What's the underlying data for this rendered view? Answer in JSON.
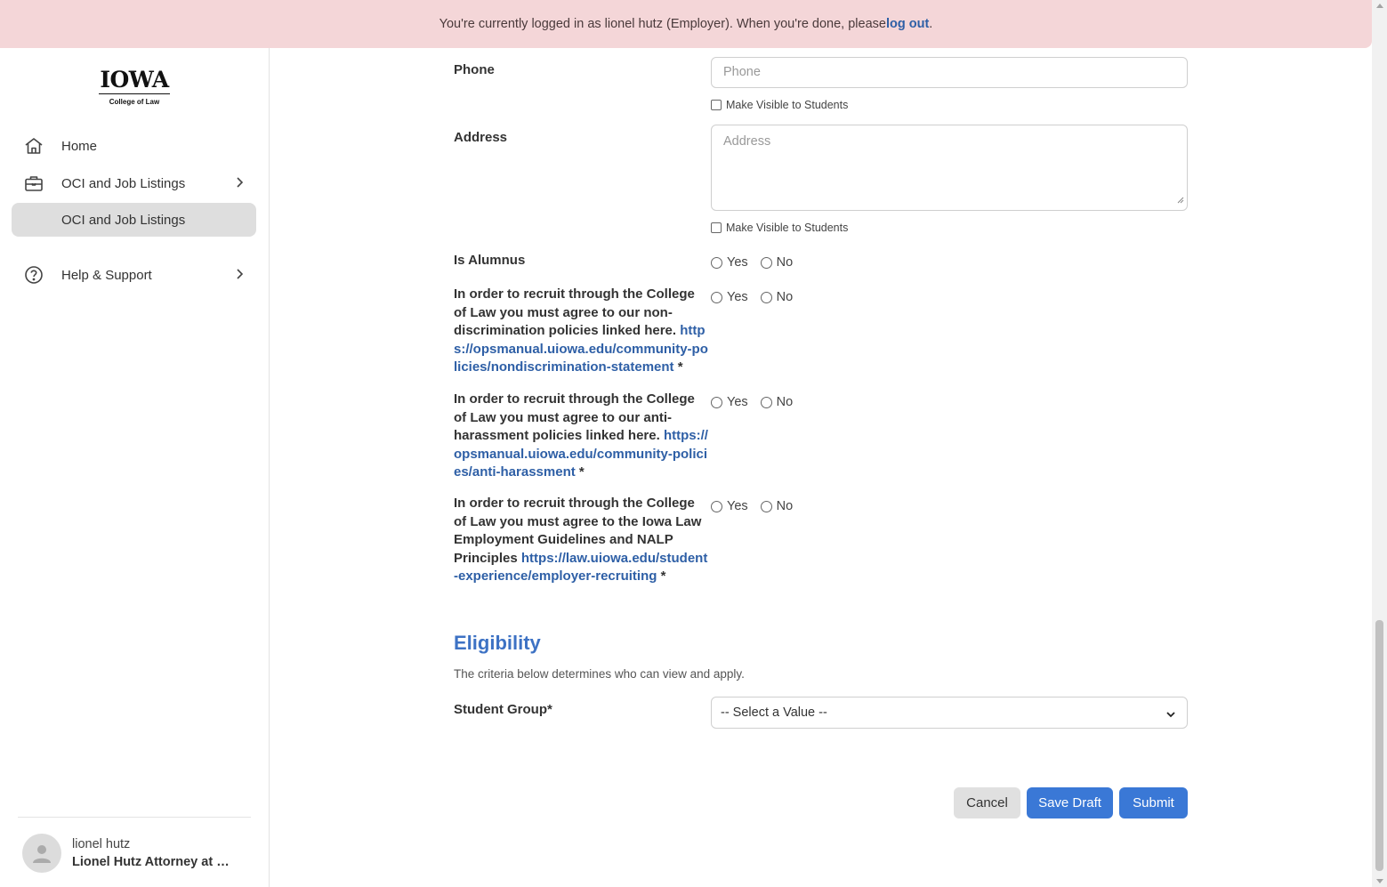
{
  "banner": {
    "text_before": "You're currently logged in as lionel hutz (Employer). When you're done, please ",
    "logout_link": "log out",
    "text_after": "."
  },
  "logo": {
    "word": "IOWA",
    "sub": "College of Law"
  },
  "sidebar": {
    "items": [
      {
        "label": "Home",
        "icon": "home-icon"
      },
      {
        "label": "OCI and Job Listings",
        "icon": "briefcase-icon"
      },
      {
        "label": "OCI and Job Listings"
      },
      {
        "label": "Help & Support",
        "icon": "help-circle-icon"
      }
    ]
  },
  "user": {
    "name": "lionel hutz",
    "org": "Lionel Hutz Attorney at Law"
  },
  "form": {
    "phone": {
      "label": "Phone",
      "placeholder": "Phone",
      "visible_label": "Make Visible to Students"
    },
    "address": {
      "label": "Address",
      "placeholder": "Address",
      "visible_label": "Make Visible to Students"
    },
    "alumnus": {
      "label": "Is Alumnus",
      "yes": "Yes",
      "no": "No"
    },
    "q1": {
      "text": "In order to recruit through the College of Law you must agree to our non-discrimination policies linked here. ",
      "link": "https://opsmanual.uiowa.edu/community-policies/nondiscrimination-statement",
      "required": " *",
      "yes": "Yes",
      "no": "No"
    },
    "q2": {
      "text": "In order to recruit through the College of Law you must agree to our anti-harassment policies linked here. ",
      "link": "https://opsmanual.uiowa.edu/community-policies/anti-harassment",
      "required": " *",
      "yes": "Yes",
      "no": "No"
    },
    "q3": {
      "text": "In order to recruit through the College of Law you must agree to the Iowa Law Employment Guidelines and NALP Principles ",
      "link": "https://law.uiowa.edu/student-experience/employer-recruiting",
      "required": " *",
      "yes": "Yes",
      "no": "No"
    }
  },
  "eligibility": {
    "title": "Eligibility",
    "description": "The criteria below determines who can view and apply.",
    "student_group_label": "Student Group*",
    "student_group_value": "-- Select a Value --"
  },
  "actions": {
    "cancel": "Cancel",
    "save_draft": "Save Draft",
    "submit": "Submit"
  },
  "colors": {
    "banner_bg": "#f4d6d8",
    "accent": "#3a78d6",
    "link": "#2e5fa6",
    "active_nav": "#dedede"
  }
}
